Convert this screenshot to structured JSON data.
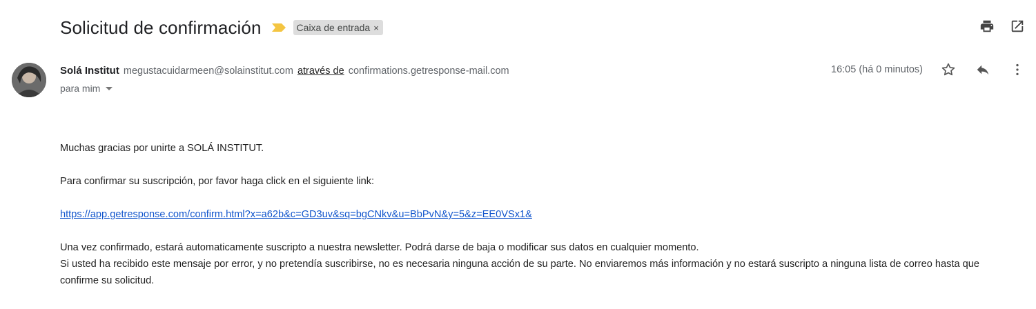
{
  "email": {
    "subject": "Solicitud de confirmación",
    "label": "Caixa de entrada",
    "label_remove": "×",
    "sender": {
      "name": "Solá Institut",
      "email": "megustacuidarmeen@solainstitut.com",
      "via_text": "através de",
      "via_domain": "confirmations.getresponse-mail.com"
    },
    "recipient_text": "para mim",
    "timestamp": "16:05 (há 0 minutos)",
    "body": {
      "line1": "Muchas gracias por unirte a SOLÁ INSTITUT.",
      "line2": "Para confirmar su suscripción, por favor haga click en el siguiente link:",
      "link": "https://app.getresponse.com/confirm.html?x=a62b&c=GD3uv&sq=bgCNkv&u=BbPvN&y=5&z=EE0VSx1&",
      "line3": "Una vez confirmado, estará automaticamente suscripto a nuestra newsletter. Podrá darse de baja o modificar sus datos en cualquier momento.",
      "line4": "Si usted ha recibido este mensaje por error, y no pretendía suscribirse, no es necesaria ninguna acción de su parte. No enviaremos más información y no estará suscripto a ninguna lista de correo hasta que confirme su solicitud."
    }
  },
  "icons": {
    "importance": "importance-marker-icon",
    "print": "print-icon",
    "open_new_window": "open-in-new-window-icon",
    "star": "star-icon",
    "reply": "reply-icon",
    "more": "more-vertical-icon"
  },
  "colors": {
    "importance_marker": "#f4c542",
    "label_chip_bg": "#dddddd",
    "link": "#1155cc"
  }
}
